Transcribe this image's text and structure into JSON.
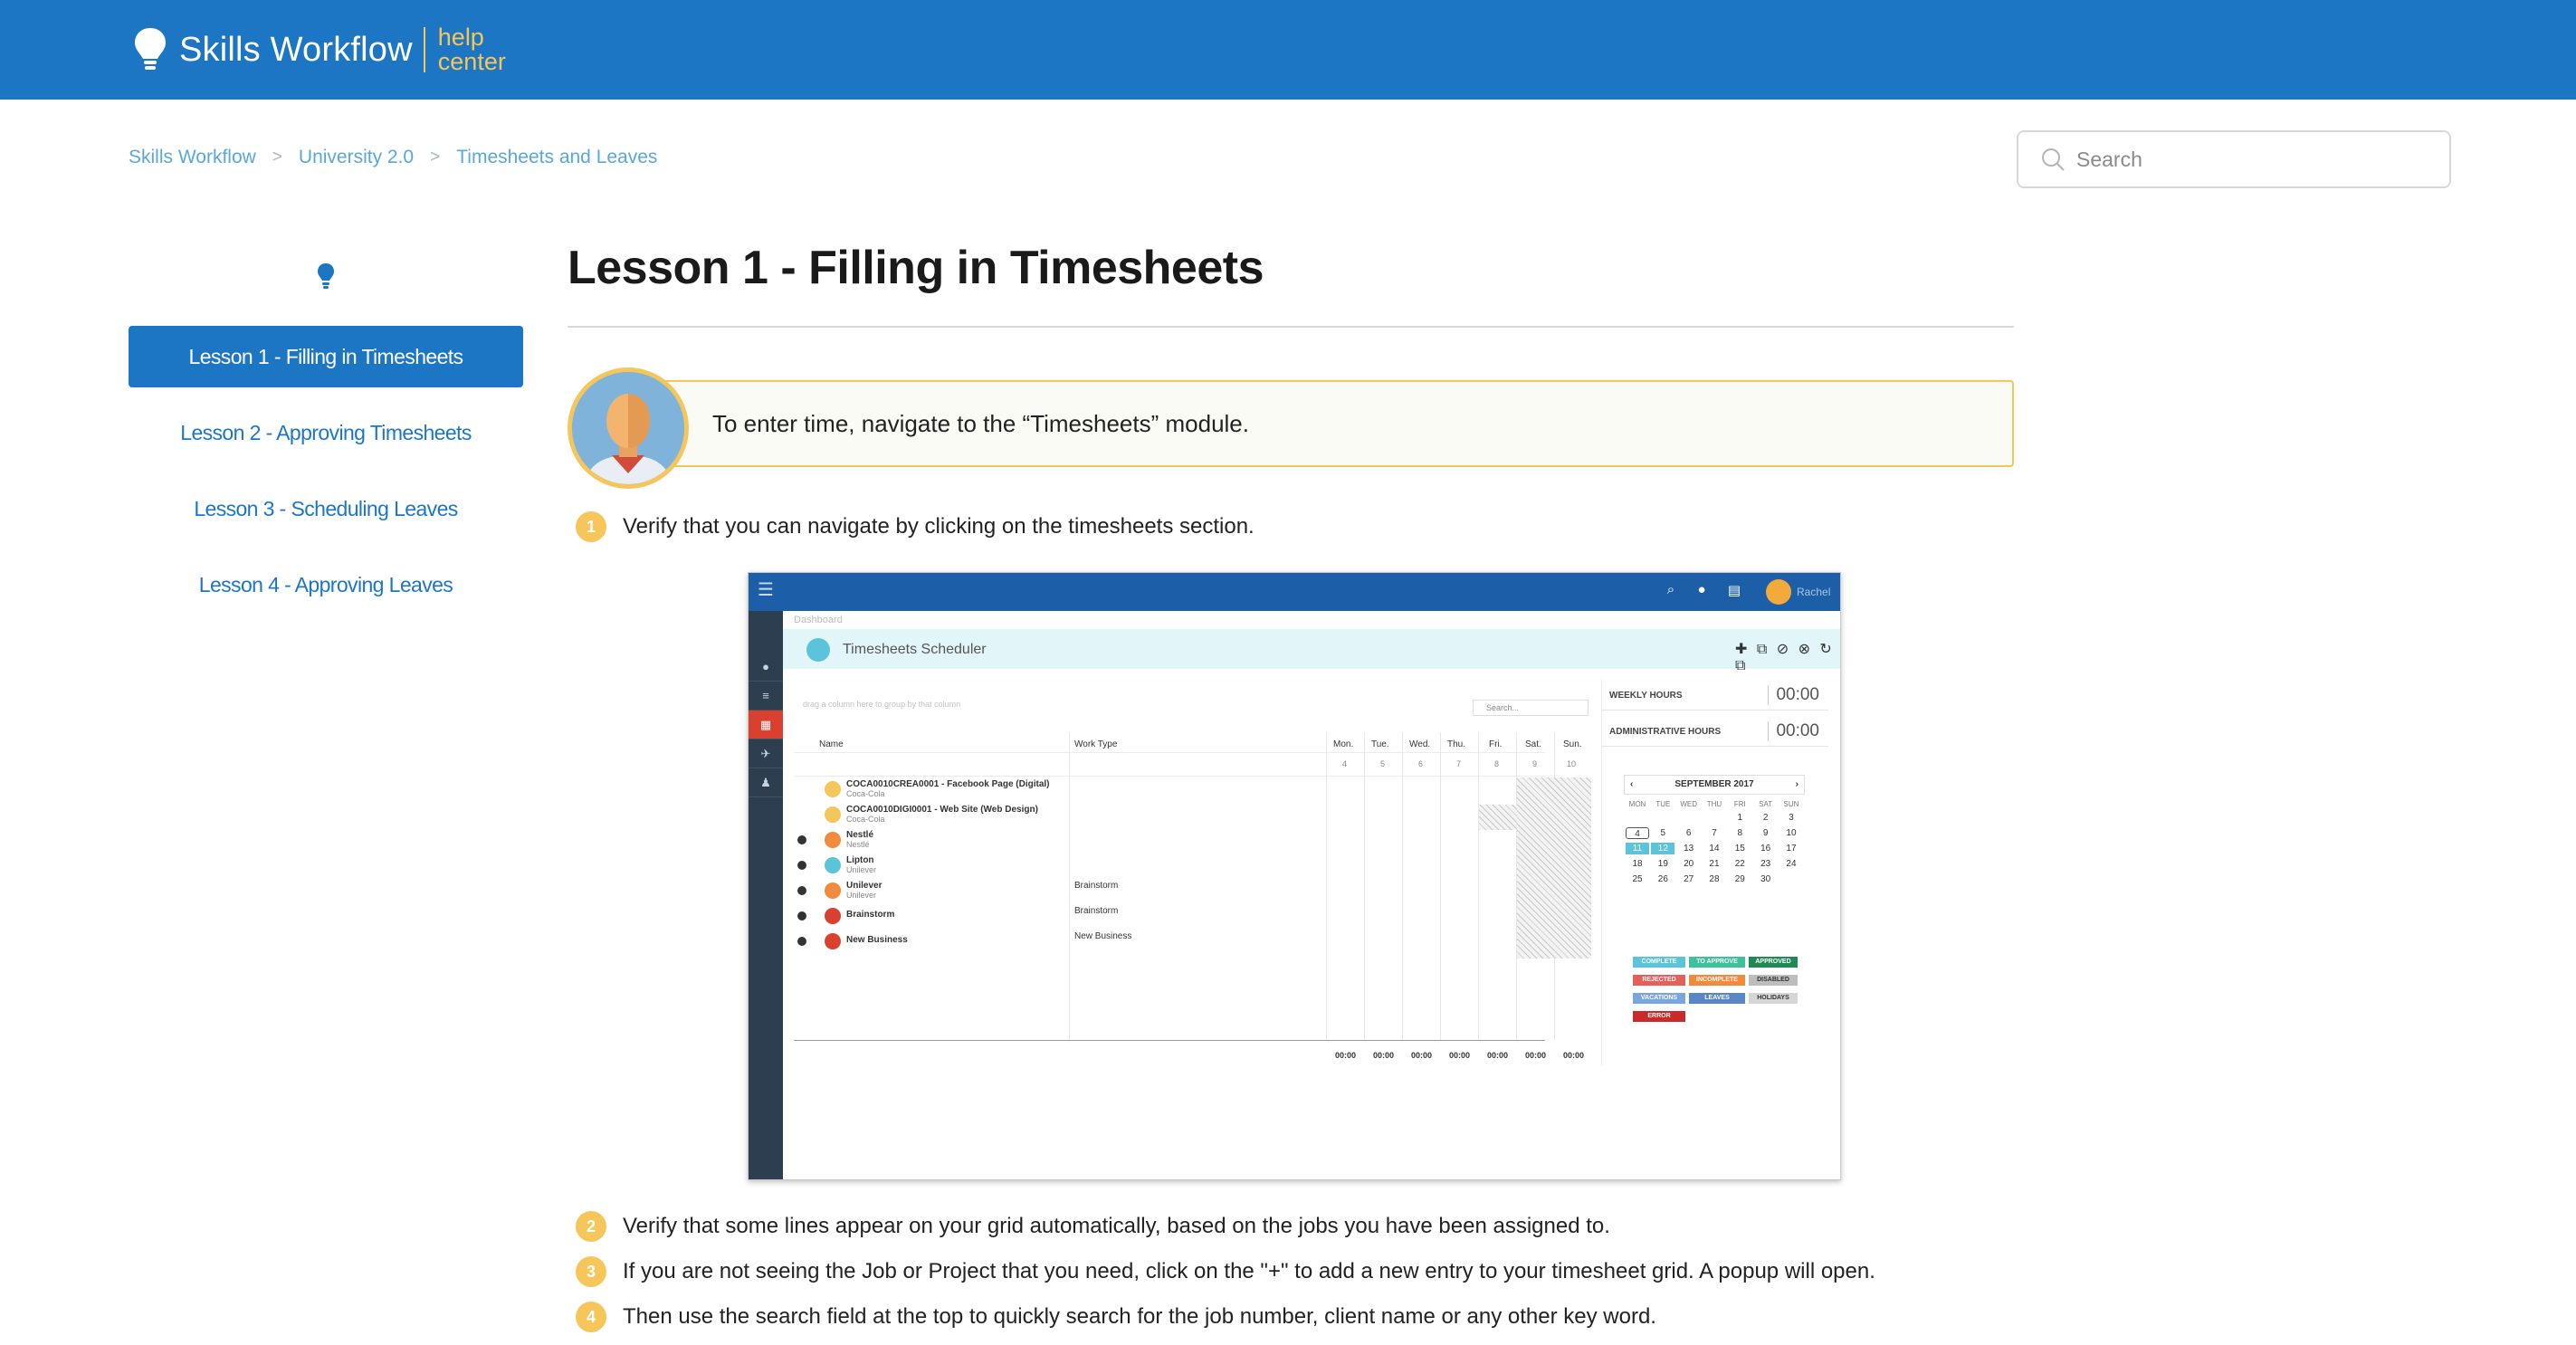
{
  "header": {
    "brand_name": "Skills Workflow",
    "help_center_line1": "help",
    "help_center_line2": "center",
    "bg_color": "#1c76c4",
    "accent_color": "#f4c65b"
  },
  "breadcrumb": [
    "Skills Workflow",
    "University 2.0",
    "Timesheets and Leaves"
  ],
  "breadcrumb_separator": ">",
  "search": {
    "placeholder": "Search",
    "icon": "search-icon"
  },
  "sidebar": {
    "icon": "lightbulb-icon",
    "items": [
      {
        "label": "Lesson 1 - Filling in Timesheets",
        "active": true
      },
      {
        "label": "Lesson 2 - Approving Timesheets",
        "active": false
      },
      {
        "label": "Lesson 3 - Scheduling Leaves",
        "active": false
      },
      {
        "label": "Lesson 4 - Approving Leaves",
        "active": false
      }
    ]
  },
  "article": {
    "title": "Lesson 1 - Filling in Timesheets",
    "note": "To enter time, navigate to the “Timesheets” module.",
    "steps": [
      {
        "num": "1",
        "text": "Verify that you can navigate by clicking on the timesheets section."
      },
      {
        "num": "2",
        "text": "Verify that some lines appear on your grid automatically, based on the jobs you have been assigned to."
      },
      {
        "num": "3",
        "text": "If you are not seeing the Job or Project that you need, click on the \"+\" to add a new entry to your timesheet grid. A popup will open."
      },
      {
        "num": "4",
        "text": "Then use the search field at the top to quickly search for the job number, client name or any other key word."
      }
    ]
  },
  "screenshot": {
    "user": "Rachel",
    "breadcrumb": "Dashboard",
    "module_title": "Timesheets Scheduler",
    "tools": "✚ ⧉ ⊘ ⊗ ↻ ⧉",
    "group_hint": "drag a column here to group by that column",
    "search_placeholder": "Search...",
    "columns": {
      "name": "Name",
      "work_type": "Work Type"
    },
    "days": [
      {
        "label": "Mon.",
        "num": "4"
      },
      {
        "label": "Tue.",
        "num": "5"
      },
      {
        "label": "Wed.",
        "num": "6"
      },
      {
        "label": "Thu.",
        "num": "7"
      },
      {
        "label": "Fri.",
        "num": "8"
      },
      {
        "label": "Sat.",
        "num": "9"
      },
      {
        "label": "Sun.",
        "num": "10"
      }
    ],
    "rows": [
      {
        "name": "COCA0010CREA0001 - Facebook Page (Digital)",
        "sub": "Coca-Cola",
        "work": "",
        "color": "#f4c65b",
        "expand": false
      },
      {
        "name": "COCA0010DIGI0001 - Web Site (Web Design)",
        "sub": "Coca-Cola",
        "work": "",
        "color": "#f4c65b",
        "expand": false
      },
      {
        "name": "Nestlé",
        "sub": "Nestlé",
        "work": "",
        "color": "#f08a3c",
        "expand": true
      },
      {
        "name": "Lipton",
        "sub": "Unilever",
        "work": "",
        "color": "#5bc4da",
        "expand": true
      },
      {
        "name": "Unilever",
        "sub": "Unilever",
        "work": "Brainstorm",
        "color": "#f08a3c",
        "expand": true
      },
      {
        "name": "Brainstorm",
        "sub": "",
        "work": "Brainstorm",
        "color": "#d9402f",
        "expand": true
      },
      {
        "name": "New Business",
        "sub": "",
        "work": "New Business",
        "color": "#d9402f",
        "expand": true
      }
    ],
    "totals": [
      "00:00",
      "00:00",
      "00:00",
      "00:00",
      "00:00",
      "00:00",
      "00:00"
    ],
    "weekly_hours_label": "WEEKLY HOURS",
    "weekly_hours_value": "00:00",
    "admin_hours_label": "ADMINISTRATIVE HOURS",
    "admin_hours_value": "00:00",
    "calendar": {
      "month": "SEPTEMBER 2017",
      "weekdays": [
        "MON",
        "TUE",
        "WED",
        "THU",
        "FRI",
        "SAT",
        "SUN"
      ],
      "weeks": [
        [
          "",
          "",
          "",
          "",
          "1",
          "2",
          "3"
        ],
        [
          "4",
          "5",
          "6",
          "7",
          "8",
          "9",
          "10"
        ],
        [
          "11",
          "12",
          "13",
          "14",
          "15",
          "16",
          "17"
        ],
        [
          "18",
          "19",
          "20",
          "21",
          "22",
          "23",
          "24"
        ],
        [
          "25",
          "26",
          "27",
          "28",
          "29",
          "30",
          ""
        ]
      ]
    },
    "legend": [
      {
        "label": "COMPLETE",
        "color": "#5bc4da"
      },
      {
        "label": "TO APPROVE",
        "color": "#3cc19a"
      },
      {
        "label": "APPROVED",
        "color": "#1f8a55"
      },
      {
        "label": "REJECTED",
        "color": "#e4605a"
      },
      {
        "label": "INCOMPLETE",
        "color": "#f08a3c"
      },
      {
        "label": "DISABLED",
        "color": "#bdbdbd"
      },
      {
        "label": "VACATIONS",
        "color": "#7aa6e0"
      },
      {
        "label": "LEAVES",
        "color": "#5a86c8"
      },
      {
        "label": "HOLIDAYS",
        "color": "#d6d6d6"
      },
      {
        "label": "ERROR",
        "color": "#c92b2b"
      }
    ]
  }
}
